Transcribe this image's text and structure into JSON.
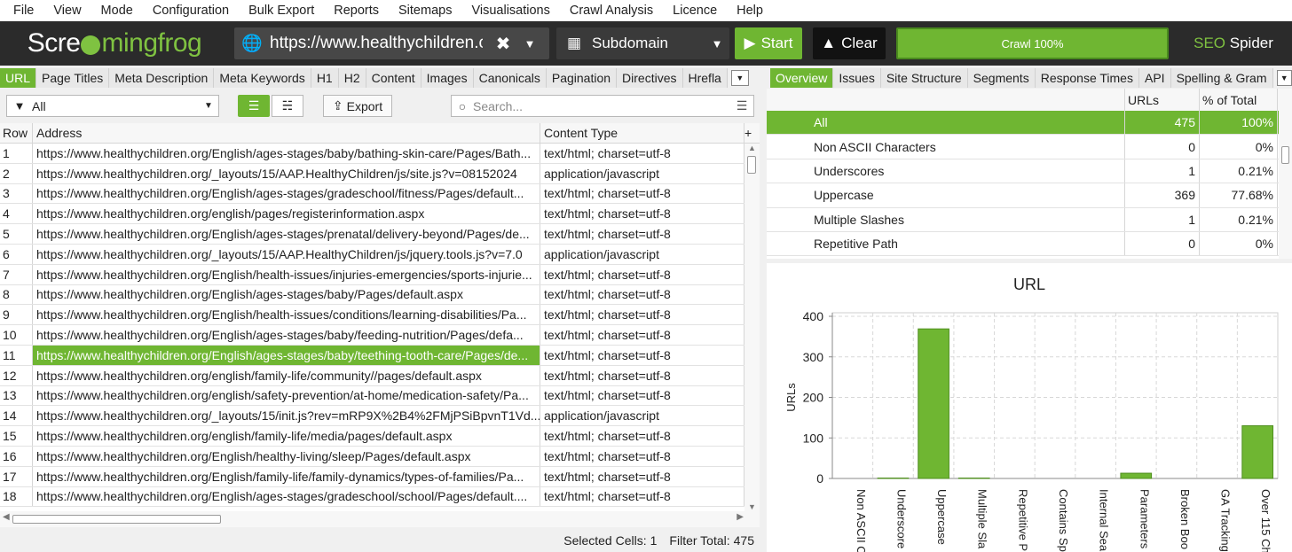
{
  "menu": [
    "File",
    "View",
    "Mode",
    "Configuration",
    "Bulk Export",
    "Reports",
    "Sitemaps",
    "Visualisations",
    "Crawl Analysis",
    "Licence",
    "Help"
  ],
  "logo": {
    "pre": "Scre",
    "post": "mingfrog"
  },
  "url_bar": {
    "value": "https://www.healthychildren.c"
  },
  "mode": {
    "label": "Subdomain"
  },
  "start_label": "Start",
  "clear_label": "Clear",
  "crawl_progress": {
    "label": "Crawl 100%",
    "percent": 100
  },
  "brand": {
    "a": "SEO",
    "b": "Spider"
  },
  "left_tabs": [
    "URL",
    "Page Titles",
    "Meta Description",
    "Meta Keywords",
    "H1",
    "H2",
    "Content",
    "Images",
    "Canonicals",
    "Pagination",
    "Directives",
    "Hrefla"
  ],
  "filter": {
    "value": "All"
  },
  "export_label": "Export",
  "search_placeholder": "Search...",
  "grid": {
    "headers": [
      "Row",
      "Address",
      "Content Type"
    ],
    "rows": [
      [
        "1",
        "https://www.healthychildren.org/English/ages-stages/baby/bathing-skin-care/Pages/Bath...",
        "text/html; charset=utf-8"
      ],
      [
        "2",
        "https://www.healthychildren.org/_layouts/15/AAP.HealthyChildren/js/site.js?v=08152024",
        "application/javascript"
      ],
      [
        "3",
        "https://www.healthychildren.org/English/ages-stages/gradeschool/fitness/Pages/default...",
        "text/html; charset=utf-8"
      ],
      [
        "4",
        "https://www.healthychildren.org/english/pages/registerinformation.aspx",
        "text/html; charset=utf-8"
      ],
      [
        "5",
        "https://www.healthychildren.org/English/ages-stages/prenatal/delivery-beyond/Pages/de...",
        "text/html; charset=utf-8"
      ],
      [
        "6",
        "https://www.healthychildren.org/_layouts/15/AAP.HealthyChildren/js/jquery.tools.js?v=7.0",
        "application/javascript"
      ],
      [
        "7",
        "https://www.healthychildren.org/English/health-issues/injuries-emergencies/sports-injurie...",
        "text/html; charset=utf-8"
      ],
      [
        "8",
        "https://www.healthychildren.org/English/ages-stages/baby/Pages/default.aspx",
        "text/html; charset=utf-8"
      ],
      [
        "9",
        "https://www.healthychildren.org/English/health-issues/conditions/learning-disabilities/Pa...",
        "text/html; charset=utf-8"
      ],
      [
        "10",
        "https://www.healthychildren.org/English/ages-stages/baby/feeding-nutrition/Pages/defa...",
        "text/html; charset=utf-8"
      ],
      [
        "11",
        "https://www.healthychildren.org/English/ages-stages/baby/teething-tooth-care/Pages/de...",
        "text/html; charset=utf-8"
      ],
      [
        "12",
        "https://www.healthychildren.org/english/family-life/community//pages/default.aspx",
        "text/html; charset=utf-8"
      ],
      [
        "13",
        "https://www.healthychildren.org/english/safety-prevention/at-home/medication-safety/Pa...",
        "text/html; charset=utf-8"
      ],
      [
        "14",
        "https://www.healthychildren.org/_layouts/15/init.js?rev=mRP9X%2B4%2FMjPSiBpvnT1Vd...",
        "application/javascript"
      ],
      [
        "15",
        "https://www.healthychildren.org/english/family-life/media/pages/default.aspx",
        "text/html; charset=utf-8"
      ],
      [
        "16",
        "https://www.healthychildren.org/English/healthy-living/sleep/Pages/default.aspx",
        "text/html; charset=utf-8"
      ],
      [
        "17",
        "https://www.healthychildren.org/English/family-life/family-dynamics/types-of-families/Pa...",
        "text/html; charset=utf-8"
      ],
      [
        "18",
        "https://www.healthychildren.org/English/ages-stages/gradeschool/school/Pages/default....",
        "text/html; charset=utf-8"
      ]
    ],
    "selected_row": 11
  },
  "status": {
    "selected_label": "Selected Cells:",
    "selected_value": "1",
    "filter_label": "Filter Total:",
    "filter_value": "475"
  },
  "right_tabs": [
    "Overview",
    "Issues",
    "Site Structure",
    "Segments",
    "Response Times",
    "API",
    "Spelling & Gram"
  ],
  "overview": {
    "headers": [
      "",
      "URLs",
      "% of Total"
    ],
    "rows": [
      [
        "All",
        "475",
        "100%"
      ],
      [
        "Non ASCII Characters",
        "0",
        "0%"
      ],
      [
        "Underscores",
        "1",
        "0.21%"
      ],
      [
        "Uppercase",
        "369",
        "77.68%"
      ],
      [
        "Multiple Slashes",
        "1",
        "0.21%"
      ],
      [
        "Repetitive Path",
        "0",
        "0%"
      ]
    ]
  },
  "chart_data": {
    "type": "bar",
    "title": "URL",
    "ylabel": "URLs",
    "ylim": [
      0,
      400
    ],
    "yticks": [
      "0",
      "100",
      "200",
      "300",
      "400"
    ],
    "categories": [
      "Non ASCII C",
      "Underscore",
      "Uppercase",
      "Multiple Sla",
      "Repetitive P",
      "Contains Sp",
      "Internal Sea",
      "Parameters",
      "Broken Boo",
      "GA Tracking",
      "Over 115 Ch"
    ],
    "values": [
      0,
      1,
      369,
      1,
      0,
      0,
      0,
      13,
      0,
      0,
      130
    ],
    "bar_color": "#6fb632"
  }
}
